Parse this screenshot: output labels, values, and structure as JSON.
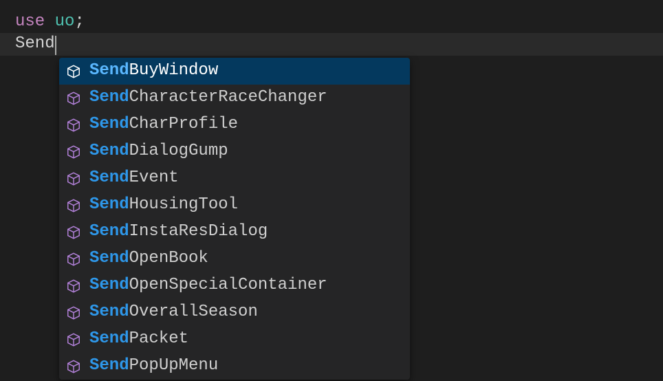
{
  "code": {
    "line1": {
      "use": "use",
      "module": "uo",
      "semi": ";"
    },
    "line2": {
      "typed": "Send"
    }
  },
  "suggest_prefix": "Send",
  "suggestions": [
    {
      "rest": "BuyWindow",
      "selected": true
    },
    {
      "rest": "CharacterRaceChanger",
      "selected": false
    },
    {
      "rest": "CharProfile",
      "selected": false
    },
    {
      "rest": "DialogGump",
      "selected": false
    },
    {
      "rest": "Event",
      "selected": false
    },
    {
      "rest": "HousingTool",
      "selected": false
    },
    {
      "rest": "InstaResDialog",
      "selected": false
    },
    {
      "rest": "OpenBook",
      "selected": false
    },
    {
      "rest": "OpenSpecialContainer",
      "selected": false
    },
    {
      "rest": "OverallSeason",
      "selected": false
    },
    {
      "rest": "Packet",
      "selected": false
    },
    {
      "rest": "PopUpMenu",
      "selected": false
    }
  ],
  "colors": {
    "bg": "#1e1e1e",
    "suggest_bg": "#252526",
    "selected_bg": "#04395e",
    "match": "#2e97e9",
    "keyword": "#c585c0",
    "module": "#4fc1b0"
  },
  "icon_names": {
    "method": "module-icon"
  }
}
